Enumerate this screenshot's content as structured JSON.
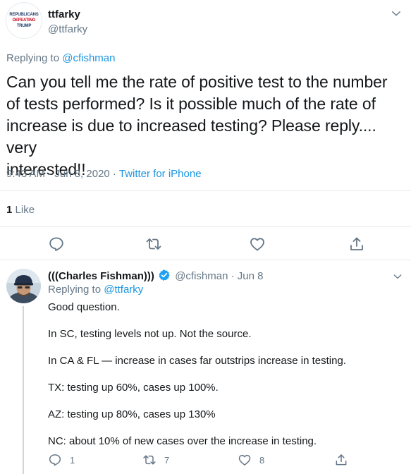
{
  "main_tweet": {
    "avatar_text": [
      "REPUBLICANS",
      "DEFEATING",
      "TRUMP"
    ],
    "author_name": "ttfarky",
    "author_handle": "@ttfarky",
    "replying_prefix": "Replying to",
    "replying_to": "@cfishman",
    "text": "Can you tell me the rate of positive test to the number\nof tests performed? Is it possible much of the rate of\nincrease is due to increased testing? Please reply.... very\ninterested!!",
    "time": "9:43 AM · Jun 8, 2020",
    "separator": " · ",
    "source": "Twitter for iPhone",
    "likes_count": "1",
    "likes_label": "Like",
    "icons": [
      "reply-icon",
      "retweet-icon",
      "like-icon",
      "share-icon",
      "chevron-down-icon"
    ]
  },
  "reply_tweet": {
    "author_name": "(((Charles Fishman)))",
    "author_handle": "@cfishman",
    "date": "· Jun 8",
    "replying_prefix": "Replying to",
    "replying_to": "@ttfarky",
    "paragraphs": [
      "Good question.",
      "In SC, testing levels not up. Not the source.",
      "In CA & FL — increase in cases far outstrips increase in testing.",
      "TX: testing up 60%, cases up 100%.",
      "AZ: testing up 80%, cases up 130%",
      "NC: about 10% of new cases over the increase in testing."
    ],
    "reply_count": "1",
    "retweet_count": "7",
    "like_count": "8",
    "icons": [
      "verified-icon",
      "reply-icon",
      "retweet-icon",
      "like-icon",
      "share-icon",
      "chevron-down-icon"
    ]
  },
  "colors": {
    "text": "#14171a",
    "muted": "#657786",
    "link": "#1b95e0",
    "divider": "#e6ecf0",
    "verified": "#1da1f2"
  }
}
